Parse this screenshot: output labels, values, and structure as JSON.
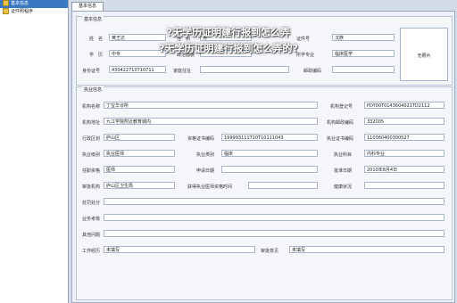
{
  "sidebar": {
    "items": [
      {
        "label": "基本信息",
        "selected": true
      },
      {
        "label": "证件照程序",
        "selected": false
      }
    ]
  },
  "tab": {
    "label": "基本信息"
  },
  "watermark": {
    "line1": "?无学历证明建行报到怎么弄",
    "line2": "?无学历证明建行报到怎么弄的?"
  },
  "basic": {
    "title": "基本信息",
    "name_label": "姓　名",
    "name_value": "黄王达",
    "gender_label": "性　别",
    "gender_value": "男",
    "id_label": "证件号",
    "id_value": "",
    "id_value2": "汉族",
    "edu_label": "学　历",
    "edu_value": "中专",
    "political_label": "政治面貌",
    "political_value": "",
    "major_label": "所学专业",
    "major_value": "临床医学",
    "idcard_label": "身份证号",
    "idcard_value": "430422710710711",
    "addr_label": "家庭住址",
    "addr_value": "",
    "zip_label": "邮政编码",
    "zip_value": "",
    "photo_label": "无照片"
  },
  "practice": {
    "title": "执业信息",
    "inst_name_label": "机构名称",
    "inst_name_value": "丁宝华诊所",
    "inst_reg_label": "机构登记号",
    "inst_reg_value": "PDY00T0143604021TD2112",
    "inst_addr_label": "机构地址",
    "inst_addr_value": "九江学院附近教育城内",
    "inst_zip_label": "机构邮政编码",
    "inst_zip_value": "332005",
    "region_label": "行政区划",
    "region_value": "庐山区",
    "cert_code_label": "资格证书编码",
    "cert_code_value": "199993111T10T10111043",
    "license_code_label": "执业证书编码",
    "license_code_value": "110360400300527",
    "level_label": "执业级别",
    "level_value": "执业医师",
    "type_label": "执业类别",
    "type_value": "临床",
    "scope_label": "执业科目",
    "scope_value": "内科专业",
    "duty_label": "任职资格",
    "duty_value": "医师",
    "apply_date_label": "申请日期",
    "apply_date_value": "",
    "approve_date_label": "批准日期",
    "approve_date_value": "2010年8月4日",
    "authority_label": "审批机构",
    "authority_value": "庐山区卫生局",
    "obtain_label": "获得执业医师资格时间",
    "obtain_value": "",
    "health_label": "健康状况",
    "health_value": "",
    "punish_label": "处罚处分",
    "punish_value": "",
    "assess_label": "业务考核",
    "assess_value": "",
    "other_label": "其他问题",
    "other_value": "",
    "work_label": "工作经历",
    "work_value": "未填写",
    "opinion_label": "审批意见",
    "opinion_value": "未填写"
  }
}
